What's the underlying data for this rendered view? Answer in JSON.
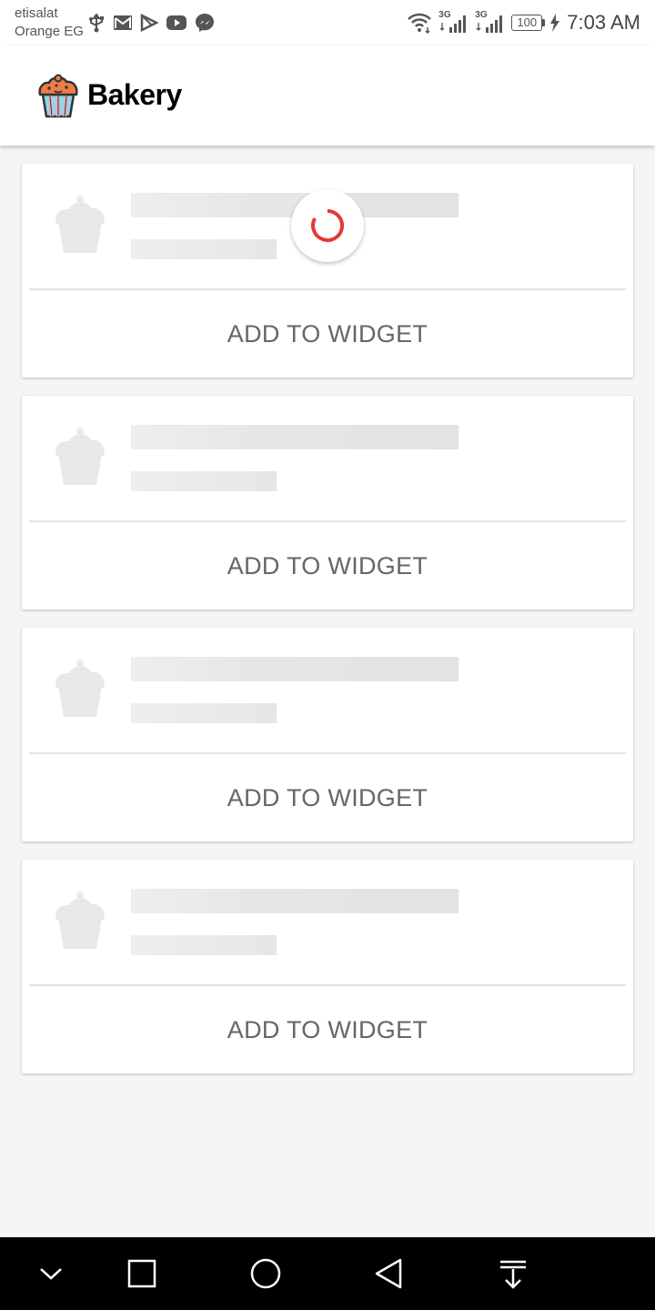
{
  "status_bar": {
    "carrier_line1": "etisalat",
    "carrier_line2": "Orange EG",
    "notifications": [
      "usb-icon",
      "gmail-icon",
      "play-store-icon",
      "youtube-icon",
      "messenger-icon"
    ],
    "network_1": "3G",
    "network_2": "3G",
    "battery": "100",
    "time": "7:03 AM"
  },
  "app_bar": {
    "title": "Bakery",
    "logo": "cupcake-icon",
    "accent": "#f07b4a"
  },
  "cards": [
    {
      "action_label": "ADD TO WIDGET",
      "loading": true
    },
    {
      "action_label": "ADD TO WIDGET",
      "loading": false
    },
    {
      "action_label": "ADD TO WIDGET",
      "loading": false
    },
    {
      "action_label": "ADD TO WIDGET",
      "loading": false
    }
  ],
  "spinner_color": "#e53935",
  "nav_bar": [
    "chevron-down-icon",
    "recents-square-icon",
    "home-circle-icon",
    "back-triangle-icon",
    "notification-pull-icon"
  ]
}
